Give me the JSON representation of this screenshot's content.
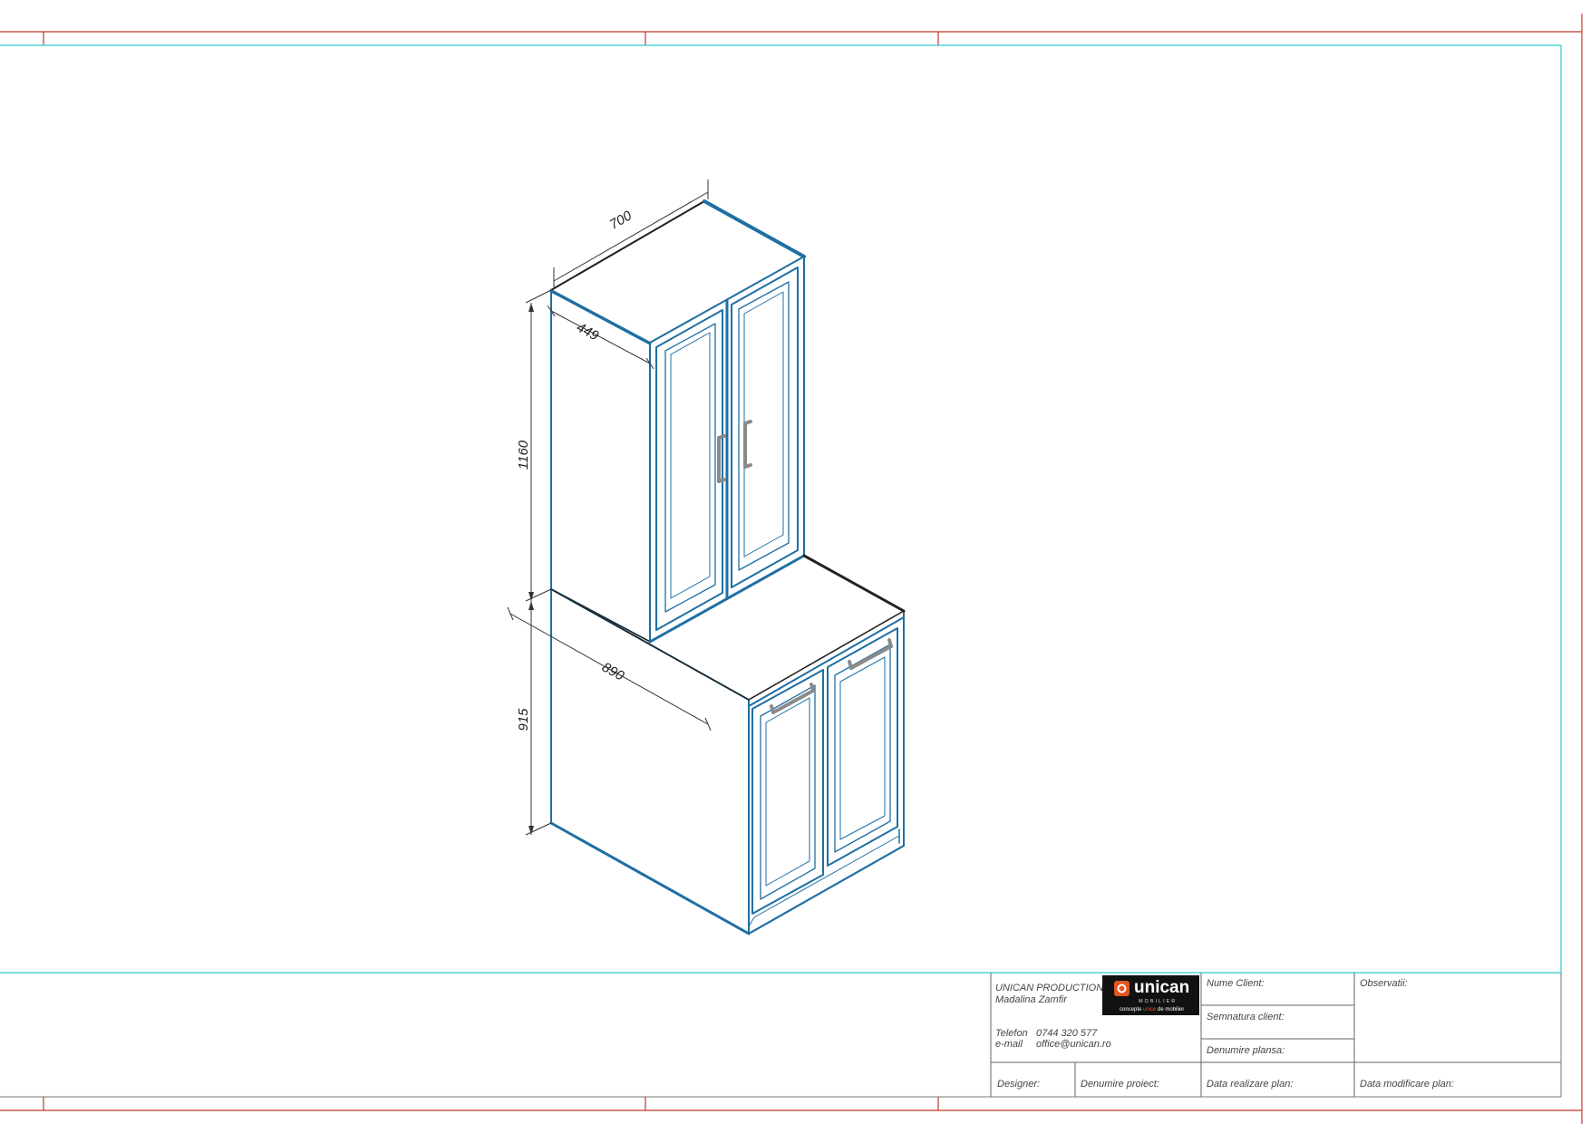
{
  "drawing": {
    "dimensions": {
      "width_top": "700",
      "depth_top": "449",
      "height_top": "1160",
      "depth_bottom": "890",
      "height_bottom": "915"
    }
  },
  "title_block": {
    "company": "UNICAN PRODUCTION",
    "person": "Madalina Zamfir",
    "phone_label": "Telefon",
    "phone": "0744 320 577",
    "email_label": "e-mail",
    "email": "office@unican.ro",
    "logo": {
      "brand": "unican",
      "subtitle": "MOBILIER",
      "tagline_pre": "concepte ",
      "tagline_accent": "unice",
      "tagline_post": " de mobilier"
    },
    "fields": {
      "client_name": "Nume Client:",
      "client_signature": "Semnatura client:",
      "sheet_name": "Denumire plansa:",
      "observations": "Observatii:",
      "designer": "Designer:",
      "project_name": "Denumire proiect:",
      "created_date": "Data realizare plan:",
      "modified_date": "Data modificare plan:"
    }
  },
  "colors": {
    "frame_red": "#c0392b",
    "frame_cyan": "#33cccc",
    "cabinet_blue": "#1f6fa3",
    "handle_gray": "#8a8a8a",
    "logo_orange": "#e2561f"
  }
}
